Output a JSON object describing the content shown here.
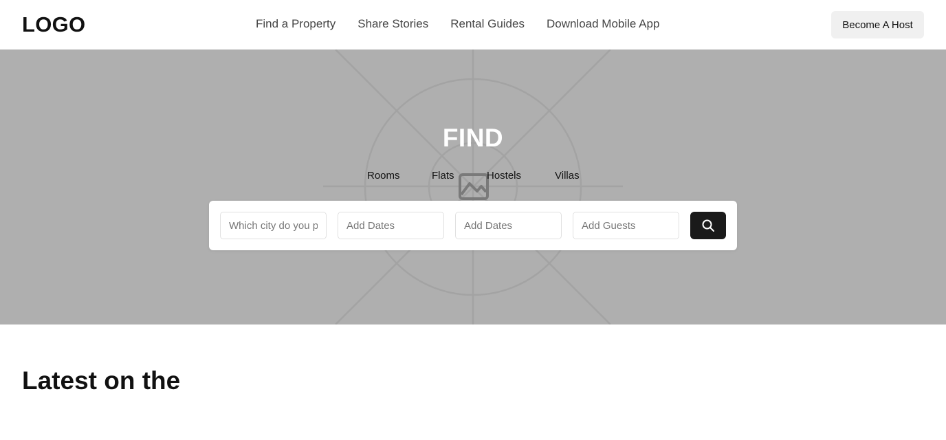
{
  "header": {
    "logo": "LOGO",
    "nav": [
      "Find a Property",
      "Share Stories",
      "Rental Guides",
      "Download Mobile App"
    ],
    "host_button": "Become A Host"
  },
  "hero": {
    "title": "FIND",
    "tabs": [
      "Rooms",
      "Flats",
      "Hostels",
      "Villas"
    ],
    "placeholder_icon": "image-icon",
    "background_color": "#afafaf",
    "search": {
      "city_placeholder": "Which city do you plan to visit?",
      "checkin_placeholder": "Add Dates",
      "checkout_placeholder": "Add Dates",
      "guests_placeholder": "Add Guests",
      "button_icon": "search-icon"
    }
  },
  "latest": {
    "heading": "Latest on the"
  }
}
